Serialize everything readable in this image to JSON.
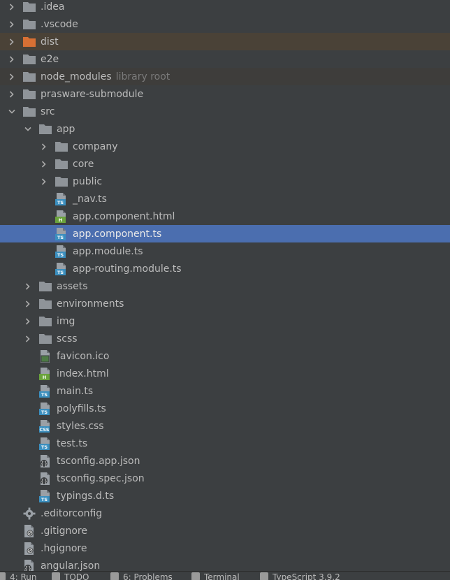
{
  "tree": [
    {
      "depth": 0,
      "kind": "folder",
      "chevron": "right",
      "label": ".idea"
    },
    {
      "depth": 0,
      "kind": "folder",
      "chevron": "right",
      "label": ".vscode"
    },
    {
      "depth": 0,
      "kind": "folder-orange",
      "chevron": "right",
      "label": "dist",
      "highlight": "dist"
    },
    {
      "depth": 0,
      "kind": "folder",
      "chevron": "right",
      "label": "e2e"
    },
    {
      "depth": 0,
      "kind": "folder",
      "chevron": "right",
      "label": "node_modules",
      "hint": "library root",
      "highlight": "nm"
    },
    {
      "depth": 0,
      "kind": "folder",
      "chevron": "right",
      "label": "prasware-submodule"
    },
    {
      "depth": 0,
      "kind": "folder",
      "chevron": "down",
      "label": "src"
    },
    {
      "depth": 1,
      "kind": "folder",
      "chevron": "down",
      "label": "app"
    },
    {
      "depth": 2,
      "kind": "folder",
      "chevron": "right",
      "label": "company"
    },
    {
      "depth": 2,
      "kind": "folder",
      "chevron": "right",
      "label": "core"
    },
    {
      "depth": 2,
      "kind": "folder",
      "chevron": "right",
      "label": "public"
    },
    {
      "depth": 2,
      "kind": "ts",
      "label": "_nav.ts"
    },
    {
      "depth": 2,
      "kind": "html",
      "label": "app.component.html"
    },
    {
      "depth": 2,
      "kind": "ts",
      "label": "app.component.ts",
      "selected": true
    },
    {
      "depth": 2,
      "kind": "ts",
      "label": "app.module.ts"
    },
    {
      "depth": 2,
      "kind": "ts",
      "label": "app-routing.module.ts"
    },
    {
      "depth": 1,
      "kind": "folder",
      "chevron": "right",
      "label": "assets"
    },
    {
      "depth": 1,
      "kind": "folder",
      "chevron": "right",
      "label": "environments"
    },
    {
      "depth": 1,
      "kind": "folder",
      "chevron": "right",
      "label": "img"
    },
    {
      "depth": 1,
      "kind": "folder",
      "chevron": "right",
      "label": "scss"
    },
    {
      "depth": 1,
      "kind": "ico",
      "label": "favicon.ico"
    },
    {
      "depth": 1,
      "kind": "html",
      "label": "index.html"
    },
    {
      "depth": 1,
      "kind": "ts",
      "label": "main.ts"
    },
    {
      "depth": 1,
      "kind": "ts",
      "label": "polyfills.ts"
    },
    {
      "depth": 1,
      "kind": "css",
      "label": "styles.css"
    },
    {
      "depth": 1,
      "kind": "ts",
      "label": "test.ts"
    },
    {
      "depth": 1,
      "kind": "json",
      "label": "tsconfig.app.json"
    },
    {
      "depth": 1,
      "kind": "json",
      "label": "tsconfig.spec.json"
    },
    {
      "depth": 1,
      "kind": "ts",
      "label": "typings.d.ts"
    },
    {
      "depth": 0,
      "kind": "gear",
      "label": ".editorconfig"
    },
    {
      "depth": 0,
      "kind": "ignore",
      "label": ".gitignore"
    },
    {
      "depth": 0,
      "kind": "ignore",
      "label": ".hgignore"
    },
    {
      "depth": 0,
      "kind": "json",
      "label": "angular.json"
    }
  ],
  "statusbar": [
    {
      "icon": "run-icon",
      "label": "4: Run"
    },
    {
      "icon": "todo-icon",
      "label": "TODO"
    },
    {
      "icon": "problems-icon",
      "label": "6: Problems"
    },
    {
      "icon": "terminal-icon",
      "label": "Terminal"
    },
    {
      "icon": "typescript-icon",
      "label": "TypeScript 3.9.2"
    }
  ],
  "colors": {
    "background": "#3c3f41",
    "selection": "#4b6eaf",
    "folder": "#8f9499",
    "folder_excluded": "#d87034",
    "ts_badge": "#3b8fbf",
    "html_badge": "#6aa33b"
  }
}
